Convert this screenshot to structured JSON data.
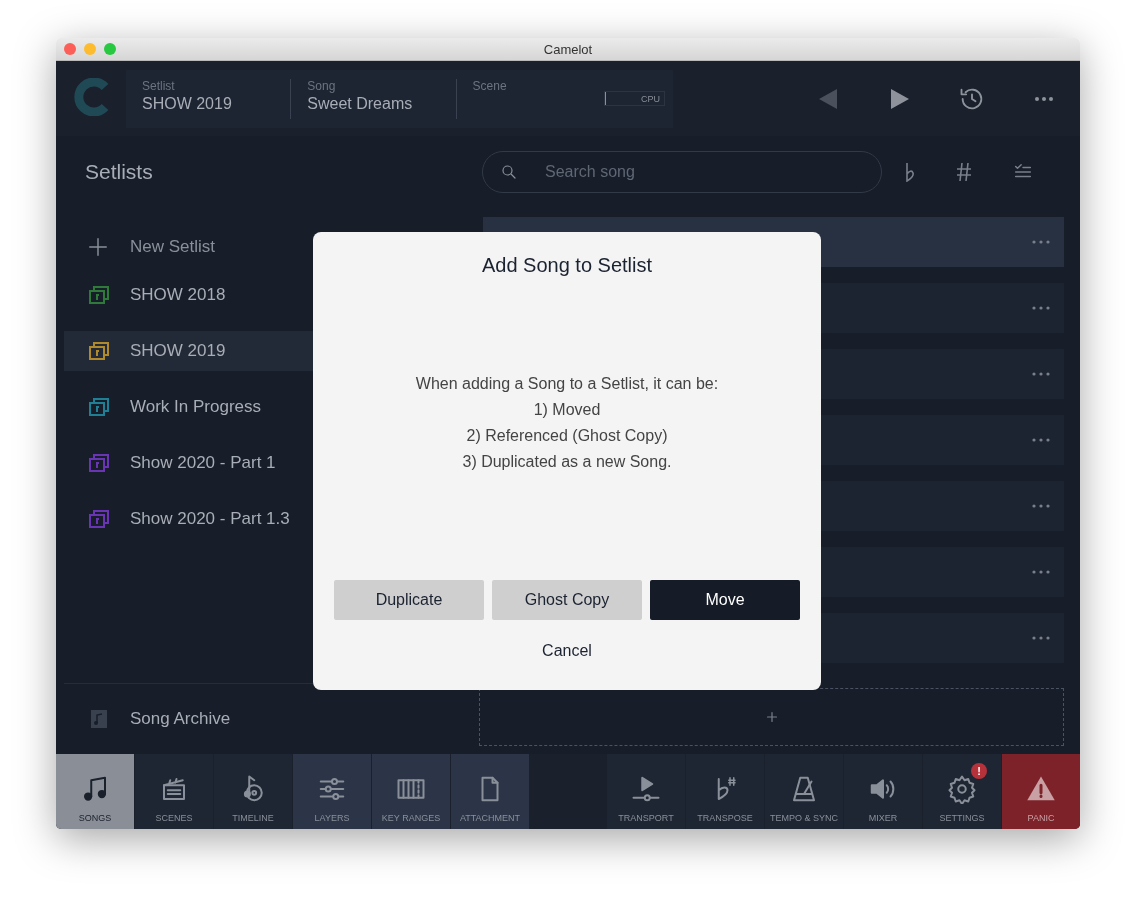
{
  "window": {
    "title": "Camelot"
  },
  "header": {
    "fields": [
      {
        "label": "Setlist",
        "value": "SHOW 2019"
      },
      {
        "label": "Song",
        "value": "Sweet Dreams"
      },
      {
        "label": "Scene"
      }
    ],
    "cpu": {
      "label": "CPU",
      "level": 0.02
    },
    "previous_disabled": true
  },
  "sidebar": {
    "title": "Setlists",
    "new_label": "New Setlist",
    "items": [
      {
        "label": "SHOW 2018",
        "color": "#2f7a3a",
        "selected": false
      },
      {
        "label": "SHOW 2019",
        "color": "#b08a2a",
        "selected": true
      },
      {
        "label": "Work In Progress",
        "color": "#1f7f95",
        "selected": false
      },
      {
        "label": "Show 2020 - Part 1",
        "color": "#6a35b5",
        "selected": false
      },
      {
        "label": "Show 2020 - Part 1.3",
        "color": "#6a35b5",
        "selected": false
      }
    ],
    "archive_label": "Song Archive"
  },
  "search": {
    "placeholder": "Search song"
  },
  "song_rows": [
    {
      "selected": true
    },
    {
      "selected": false
    },
    {
      "selected": false
    },
    {
      "selected": false
    },
    {
      "selected": false
    },
    {
      "selected": false
    },
    {
      "selected": false
    }
  ],
  "dialog": {
    "title": "Add Song to Setlist",
    "message": [
      "When adding a Song to a Setlist, it can be:",
      "1) Moved",
      "2) Referenced (Ghost Copy)",
      "3) Duplicated as a new Song."
    ],
    "buttons": [
      {
        "label": "Duplicate",
        "primary": false
      },
      {
        "label": "Ghost Copy",
        "primary": false
      },
      {
        "label": "Move",
        "primary": true
      }
    ],
    "cancel": "Cancel"
  },
  "toolbar": [
    {
      "label": "SONGS",
      "kind": "view",
      "selected": true
    },
    {
      "label": "SCENES",
      "kind": "view",
      "selected": false
    },
    {
      "label": "TIMELINE",
      "kind": "view",
      "selected": false
    },
    {
      "label": "LAYERS",
      "kind": "view-alt",
      "selected": false
    },
    {
      "label": "KEY RANGES",
      "kind": "view-alt",
      "selected": false
    },
    {
      "label": "ATTACHMENT",
      "kind": "view-alt",
      "selected": false
    },
    {
      "label": "TRANSPORT",
      "kind": "action",
      "selected": false
    },
    {
      "label": "TRANSPOSE",
      "kind": "action",
      "selected": false
    },
    {
      "label": "TEMPO & SYNC",
      "kind": "action",
      "selected": false
    },
    {
      "label": "MIXER",
      "kind": "action",
      "selected": false
    },
    {
      "label": "SETTINGS",
      "kind": "action",
      "selected": false,
      "badge": "!"
    },
    {
      "label": "PANIC",
      "kind": "panic",
      "selected": false
    }
  ]
}
